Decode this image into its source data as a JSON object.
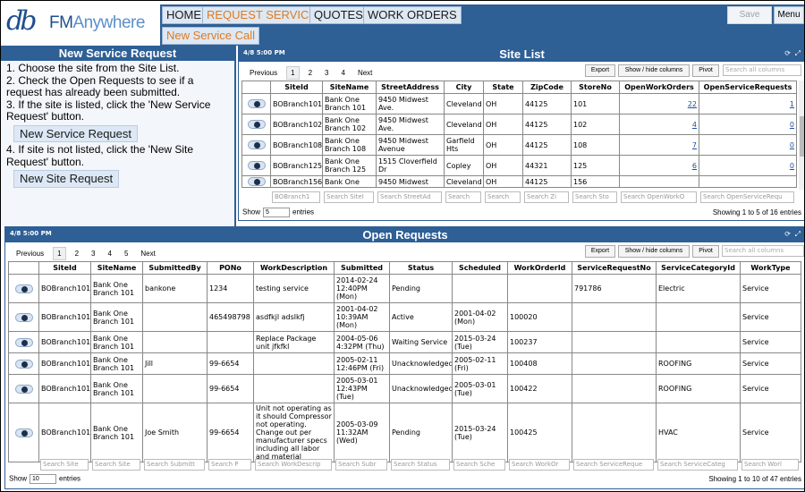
{
  "brand": {
    "mark": "db",
    "name_a": "FM",
    "name_b": "Anywhere"
  },
  "nav": {
    "tabs": [
      "HOME",
      "REQUEST SERVICE",
      "QUOTES",
      "WORK ORDERS"
    ],
    "save": "Save",
    "menu": "Menu",
    "subtab": "New Service Call"
  },
  "left": {
    "title": "New Service Request",
    "step1": "1. Choose the site from the Site List.",
    "step2": "2. Check the Open Requests to see if a request has already been submitted.",
    "step3": "3. If the site is listed, click the 'New Service Request' button.",
    "btn1": "New Service Request",
    "step4": "4. If site is not listed, click the 'New Site Request' button.",
    "btn2": "New Site Request"
  },
  "sitelist": {
    "timestamp": "4/8 5:00 PM",
    "title": "Site List",
    "pager": {
      "prev": "Previous",
      "pages": [
        "1",
        "2",
        "3",
        "4"
      ],
      "next": "Next"
    },
    "export": "Export",
    "showhide": "Show / hide columns",
    "pivot": "Pivot",
    "search_all": "Search all columns",
    "columns": [
      "",
      "SiteId",
      "SiteName",
      "StreetAddress",
      "City",
      "State",
      "ZipCode",
      "StoreNo",
      "OpenWorkOrders",
      "OpenServiceRequests"
    ],
    "rows": [
      [
        "BOBranch101",
        "Bank One Branch 101",
        "9450 Midwest Ave.",
        "Cleveland",
        "OH",
        "44125",
        "101",
        "22",
        "1"
      ],
      [
        "BOBranch102",
        "Bank One Branch 102",
        "9450 Midwest Ave.",
        "Cleveland",
        "OH",
        "44125",
        "102",
        "4",
        "0"
      ],
      [
        "BOBranch108",
        "Bank One Branch 108",
        "9450 Midwest Avenue",
        "Garfield Hts",
        "OH",
        "44125",
        "108",
        "7",
        "0"
      ],
      [
        "BOBranch125",
        "Bank One Branch 125",
        "1515 Cloverfield Dr",
        "Copley",
        "OH",
        "44321",
        "125",
        "6",
        "0"
      ],
      [
        "BOBranch156",
        "Bank One",
        "9450 Midwest",
        "Cleveland",
        "OH",
        "44125",
        "156",
        "",
        ""
      ]
    ],
    "filters": [
      "BOBranch1",
      "Search SiteI",
      "Search StreetAd",
      "Search",
      "Search",
      "Search Zi",
      "Search Sto",
      "Search OpenWorkO",
      "Search OpenServiceRequ"
    ],
    "show_label": "Show",
    "show_value": "5",
    "entries": "entries",
    "showing": "Showing 1 to 5 of 16 entries"
  },
  "openreq": {
    "timestamp": "4/8 5:00 PM",
    "title": "Open Requests",
    "pager": {
      "prev": "Previous",
      "pages": [
        "1",
        "2",
        "3",
        "4",
        "5"
      ],
      "next": "Next"
    },
    "export": "Export",
    "showhide": "Show / hide columns",
    "pivot": "Pivot",
    "search_all": "Search all columns",
    "columns": [
      "",
      "SiteId",
      "SiteName",
      "SubmittedBy",
      "PONo",
      "WorkDescription",
      "Submitted",
      "Status",
      "Scheduled",
      "WorkOrderId",
      "ServiceRequestNo",
      "ServiceCategoryId",
      "WorkType"
    ],
    "rows": [
      [
        "BOBranch101",
        "Bank One Branch 101",
        "bankone",
        "1234",
        "testing service",
        "2014-02-24 12:40PM (Mon)",
        "Pending",
        "",
        "",
        "791786",
        "Electric",
        "Service"
      ],
      [
        "BOBranch101",
        "Bank One Branch 101",
        "",
        "465498798",
        "asdfkjl adslkfj",
        "2001-04-02 10:39AM (Mon)",
        "Active",
        "2001-04-02 (Mon)",
        "100020",
        "",
        "",
        "Service"
      ],
      [
        "BOBranch101",
        "Bank One Branch 101",
        "",
        "",
        "Replace Package unit jfkfkl",
        "2004-05-06 4:32PM (Thu)",
        "Waiting Service",
        "2015-03-24 (Tue)",
        "100237",
        "",
        "",
        "Service"
      ],
      [
        "BOBranch101",
        "Bank One Branch 101",
        "Jill",
        "99-6654",
        "",
        "2005-02-11 12:46PM (Fri)",
        "Unacknowledged",
        "2005-02-11 (Fri)",
        "100408",
        "",
        "ROOFING",
        "Service"
      ],
      [
        "BOBranch101",
        "Bank One Branch 101",
        "",
        "99-6654",
        "",
        "2005-03-01 12:43PM (Tue)",
        "Unacknowledged",
        "2005-03-01 (Tue)",
        "100422",
        "",
        "ROOFING",
        "Service"
      ],
      [
        "BOBranch101",
        "Bank One Branch 101",
        "Joe Smith",
        "99-6654",
        "Unit not operating as it should Compressor not operating. Change out per manufacturer specs including all labor and material",
        "2005-03-09 11:32AM (Wed)",
        "Pending",
        "2015-03-24 (Tue)",
        "100425",
        "",
        "HVAC",
        "Service"
      ]
    ],
    "filters": [
      "Search Site",
      "Search Site",
      "Search Submitt",
      "Search P",
      "Search WorkDescrip",
      "Search Subr",
      "Search Status",
      "Search Sche",
      "Search WorkOr",
      "Search ServiceReque",
      "Search ServiceCateg",
      "Search Worl"
    ],
    "show_label": "Show",
    "show_value": "10",
    "entries": "entries",
    "showing": "Showing 1 to 10 of 47 entries"
  },
  "icons": {
    "row_action": "chevron-down-icon",
    "refresh": "refresh-icon",
    "expand": "expand-icon"
  },
  "colors": {
    "header": "#2e5f95",
    "accent": "#e07a1f",
    "link": "#1f4e9c"
  }
}
